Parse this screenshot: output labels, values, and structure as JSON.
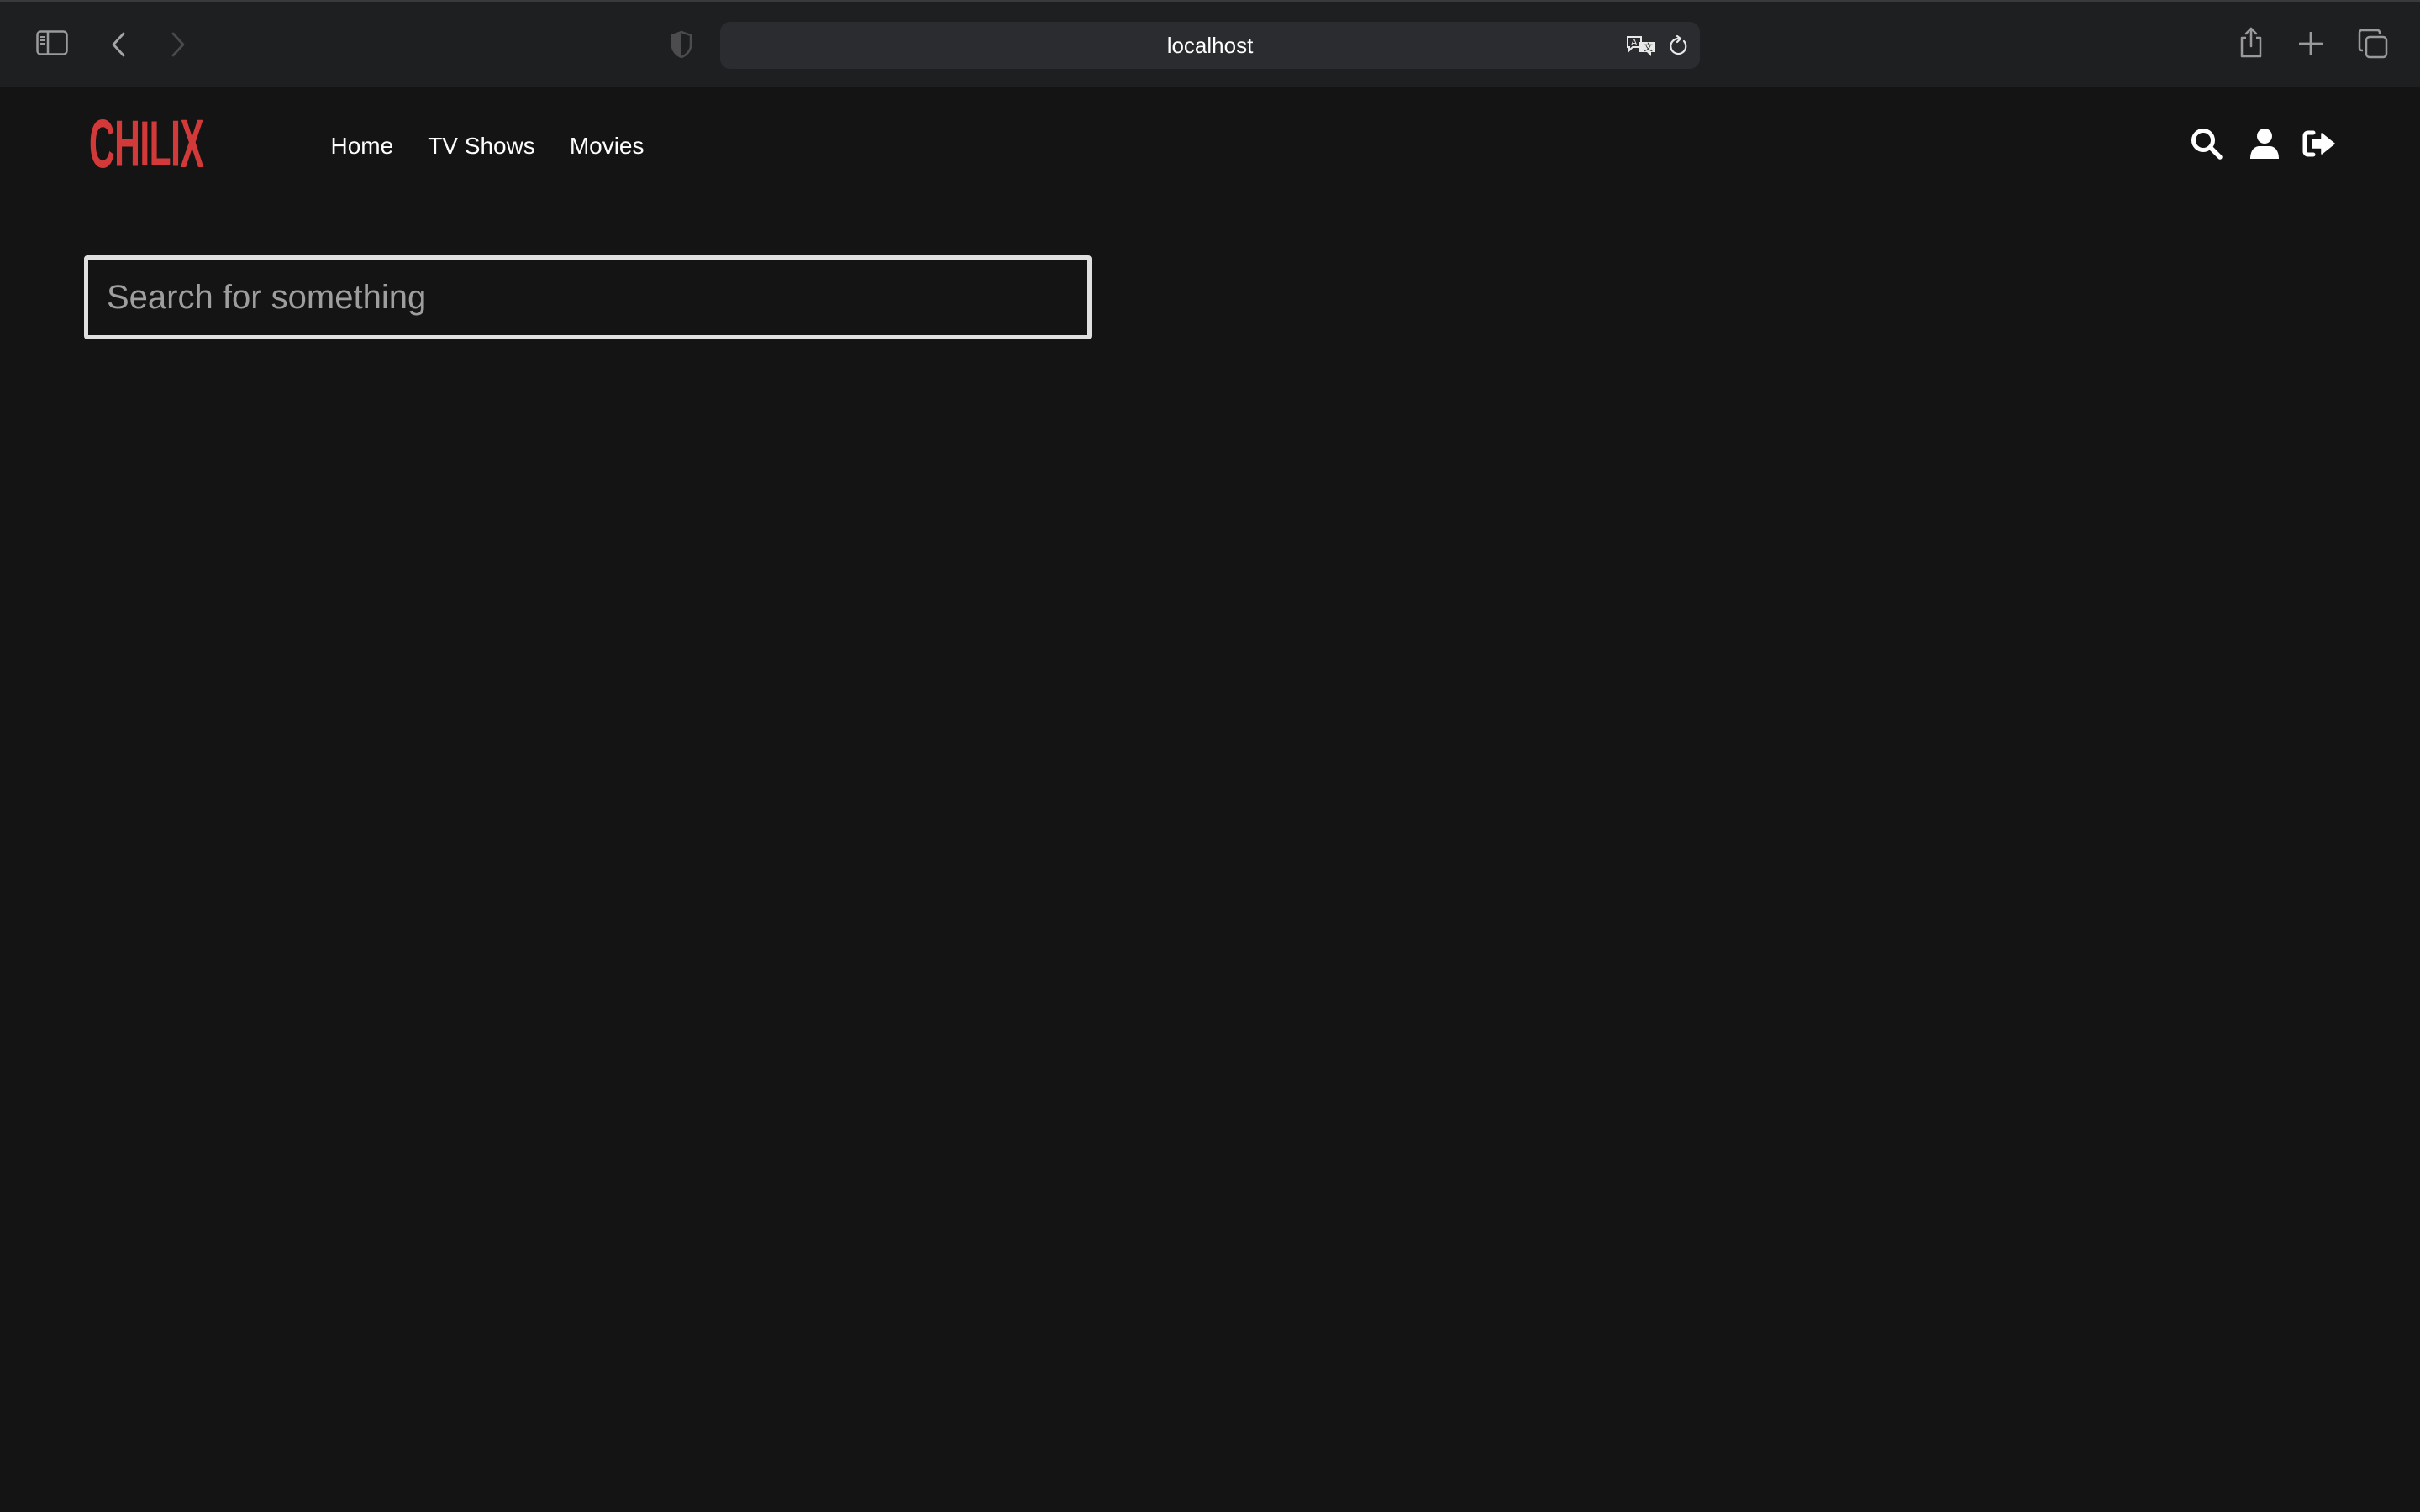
{
  "browser": {
    "url": "localhost",
    "icons": {
      "sidebar": "sidebar-toggle-icon",
      "back": "chevron-left-icon",
      "forward": "chevron-right-icon",
      "privacy": "shield-icon",
      "translate": "translate-icon",
      "reload": "reload-icon",
      "share": "share-icon",
      "new_tab": "plus-icon",
      "tabs": "tab-overview-icon"
    }
  },
  "header": {
    "logo": "CHILIX",
    "logo_color": "#d23a3a",
    "nav": [
      {
        "label": "Home"
      },
      {
        "label": "TV Shows"
      },
      {
        "label": "Movies"
      }
    ],
    "icons": {
      "search": "search-icon",
      "account": "user-icon",
      "logout": "sign-out-icon"
    }
  },
  "search": {
    "value": "",
    "placeholder": "Search for something"
  },
  "colors": {
    "page_background": "#141414",
    "toolbar_background": "#1e1f21",
    "input_border": "#e0e0e0"
  }
}
